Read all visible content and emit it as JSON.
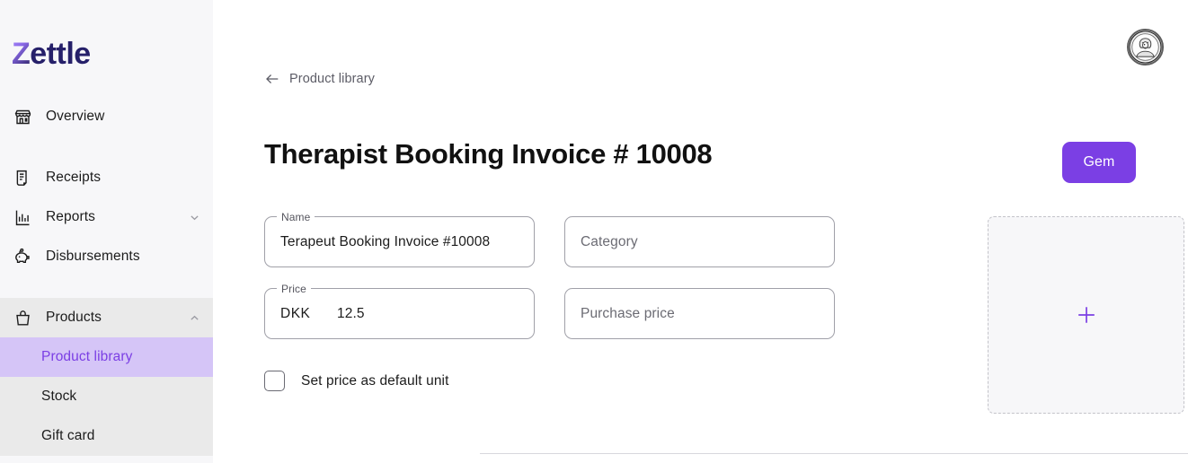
{
  "brand": {
    "logo_first": "Z",
    "logo_rest": "ettle",
    "accent_color": "#7b3fe4",
    "active_bg": "#d5c5f7",
    "logo_color": "#26206a"
  },
  "sidebar": {
    "items": [
      {
        "label": "Overview",
        "icon": "storefront-icon",
        "expandable": false
      },
      {
        "label": "Receipts",
        "icon": "receipt-icon",
        "expandable": false
      },
      {
        "label": "Reports",
        "icon": "bar-chart-icon",
        "expandable": true,
        "chevron": "chevron-down-icon"
      },
      {
        "label": "Disbursements",
        "icon": "piggy-bank-icon",
        "expandable": false
      },
      {
        "label": "Products",
        "icon": "shopping-bag-icon",
        "expandable": true,
        "chevron": "chevron-up-icon",
        "expanded": true
      }
    ],
    "products_subitems": [
      {
        "label": "Product library",
        "active": true
      },
      {
        "label": "Stock",
        "active": false
      },
      {
        "label": "Gift card",
        "active": false
      }
    ]
  },
  "header": {
    "avatar_icon": "user-avatar-icon",
    "breadcrumb": {
      "icon": "arrow-left-icon",
      "label": "Product library"
    },
    "title": "Therapist Booking Invoice # 10008",
    "save_label": "Gem"
  },
  "form": {
    "name": {
      "label": "Name",
      "value": "Terapeut Booking Invoice #10008",
      "placeholder": "Name"
    },
    "category": {
      "label": "",
      "value": "",
      "placeholder": "Category"
    },
    "price": {
      "label": "Price",
      "currency": "DKK",
      "value": "12.5",
      "placeholder": "Price"
    },
    "purchase_price": {
      "label": "",
      "value": "",
      "placeholder": "Purchase price"
    },
    "default_unit_checkbox": {
      "label": "Set price as default unit",
      "checked": false
    }
  },
  "image_upload": {
    "icon": "plus-icon",
    "label": ""
  }
}
